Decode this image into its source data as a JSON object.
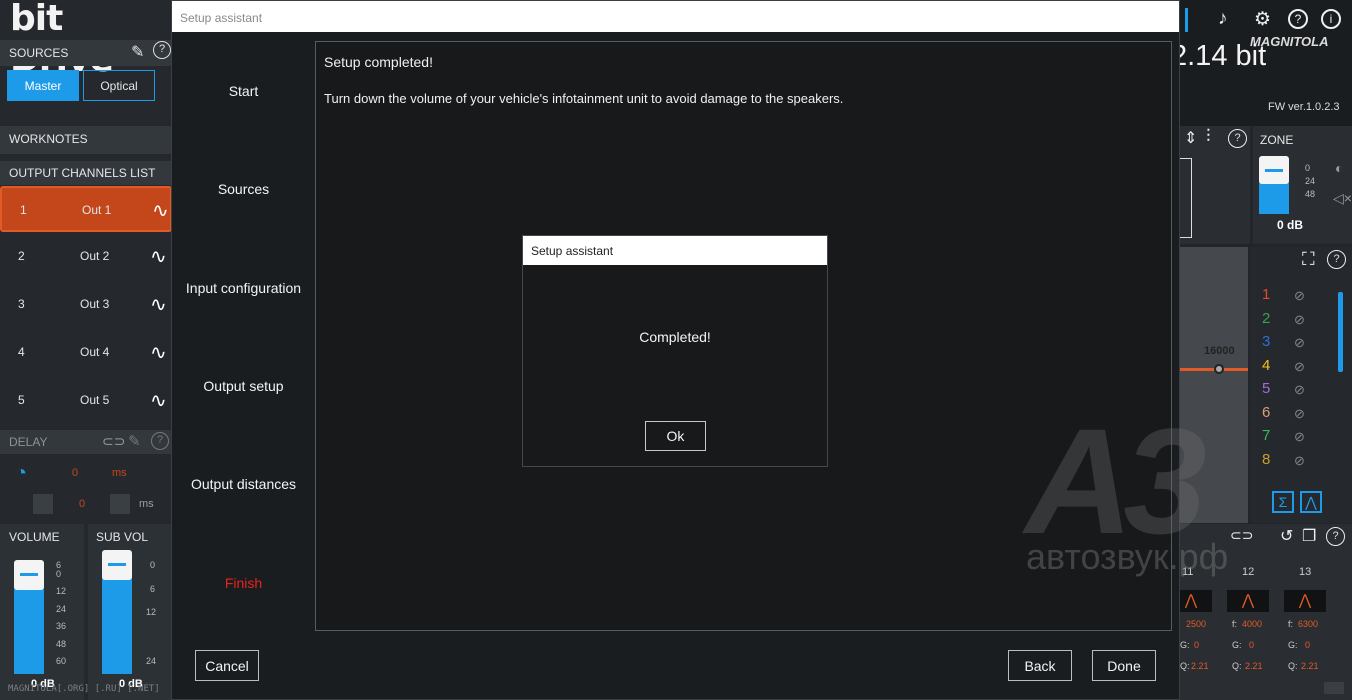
{
  "app": {
    "brand": "bit Drive",
    "sections": {
      "sources": "SOURCES",
      "worknotes": "WORKNOTES",
      "output_channels": "OUTPUT CHANNELS LIST",
      "delay": "DELAY",
      "volume": "VOLUME",
      "sub_vol": "SUB VOL",
      "zone": "ZONE"
    },
    "sources": [
      "Master",
      "Optical"
    ],
    "channels": [
      {
        "num": "1",
        "name": "Out 1"
      },
      {
        "num": "2",
        "name": "Out 2"
      },
      {
        "num": "3",
        "name": "Out 3"
      },
      {
        "num": "4",
        "name": "Out 4"
      },
      {
        "num": "5",
        "name": "Out 5"
      }
    ],
    "delay": {
      "value1": "0",
      "unit1": "ms",
      "value2": "0",
      "unit2": "ms"
    },
    "volume_scale": [
      "6",
      "0",
      "12",
      "24",
      "36",
      "48",
      "60"
    ],
    "subvol_scale": [
      "0",
      "6",
      "12",
      "24"
    ],
    "volume_db": "0 dB",
    "subvol_db": "0 dB",
    "bit_label": "2.14 bit",
    "fw_version": "FW ver.1.0.2.3",
    "zone_scale": [
      "0",
      "24",
      "48"
    ],
    "zone_db": "0 dB",
    "freq_label": "16000",
    "banks": [
      {
        "num": "1",
        "color": "#e2482a"
      },
      {
        "num": "2",
        "color": "#3aa14a"
      },
      {
        "num": "3",
        "color": "#2e6fd6"
      },
      {
        "num": "4",
        "color": "#f2c21b"
      },
      {
        "num": "5",
        "color": "#a36ad8"
      },
      {
        "num": "6",
        "color": "#d8a07a"
      },
      {
        "num": "7",
        "color": "#2fbf58"
      },
      {
        "num": "8",
        "color": "#c9a02d"
      }
    ],
    "eq_columns": [
      {
        "num": "11",
        "f": "2500",
        "g": "0",
        "q": "2.21"
      },
      {
        "num": "12",
        "f": "4000",
        "g": "0",
        "q": "2.21"
      },
      {
        "num": "13",
        "f": "6300",
        "g": "0",
        "q": "2.21"
      }
    ],
    "eq_labels": {
      "f": "f:",
      "g": "G:",
      "q": "Q:"
    },
    "logo_text": "MAGNITOLA",
    "watermark": {
      "logo": "A3",
      "site": "автозвук.рф",
      "footer": "MAGNITOLA[.ORG] [.RU] [.NET]"
    },
    "accent": "#1e9be8",
    "active_channel_color": "#c3471b"
  },
  "dialog": {
    "title": "Setup assistant",
    "steps": [
      "Start",
      "Sources",
      "Input configuration",
      "Output setup",
      "Output distances",
      "Finish"
    ],
    "current_step": "Finish",
    "content_title": "Setup completed!",
    "content_text": "Turn down the volume of your vehicle's infotainment unit to avoid damage to the speakers.",
    "buttons": {
      "cancel": "Cancel",
      "back": "Back",
      "done": "Done"
    }
  },
  "message_box": {
    "title": "Setup assistant",
    "text": "Completed!",
    "ok": "Ok"
  }
}
